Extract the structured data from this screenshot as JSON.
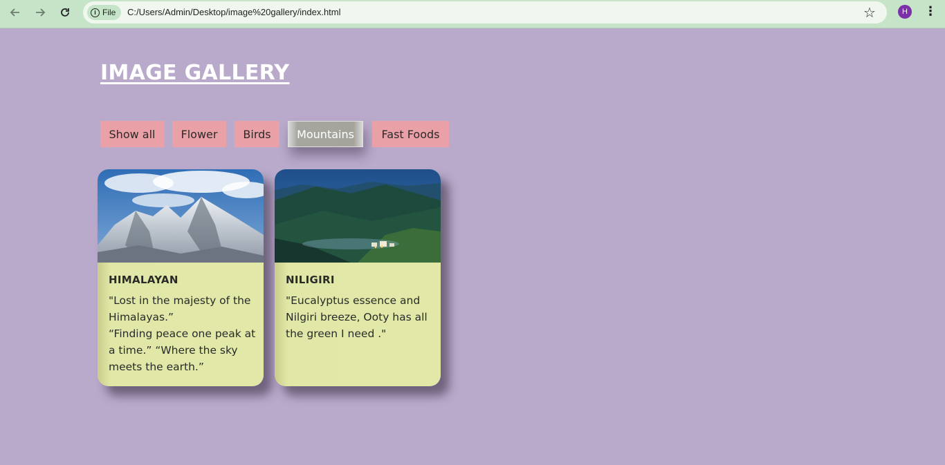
{
  "browser": {
    "back_icon": "arrow-left-icon",
    "forward_icon": "arrow-right-icon",
    "reload_icon": "reload-icon",
    "site_chip_label": "File",
    "url": "C:/Users/Admin/Desktop/image%20gallery/index.html",
    "profile_initial": "H",
    "colors": {
      "toolbar": "#c6e4c8",
      "omnibox": "#eff7ee",
      "avatar": "#7b2fa8"
    }
  },
  "page": {
    "title": "IMAGE GALLERY",
    "colors": {
      "background": "#b9a9cb",
      "filter_button": "#e9a0a6",
      "card": "#e2e9a8"
    }
  },
  "filters": [
    {
      "label": "Show all",
      "active": false
    },
    {
      "label": "Flower",
      "active": false
    },
    {
      "label": "Birds",
      "active": false
    },
    {
      "label": "Mountains",
      "active": true
    },
    {
      "label": "Fast Foods",
      "active": false
    }
  ],
  "cards": [
    {
      "title": "HIMALAYAN",
      "text_lines": [
        "\"Lost in the majesty of the Himalayas.”",
        "“Finding peace one peak at a time.” “Where the sky meets the earth.”"
      ]
    },
    {
      "title": "NILIGIRI",
      "text_lines": [
        "\"Eucalyptus essence and Nilgiri breeze, Ooty has all the green I need .\""
      ]
    }
  ]
}
